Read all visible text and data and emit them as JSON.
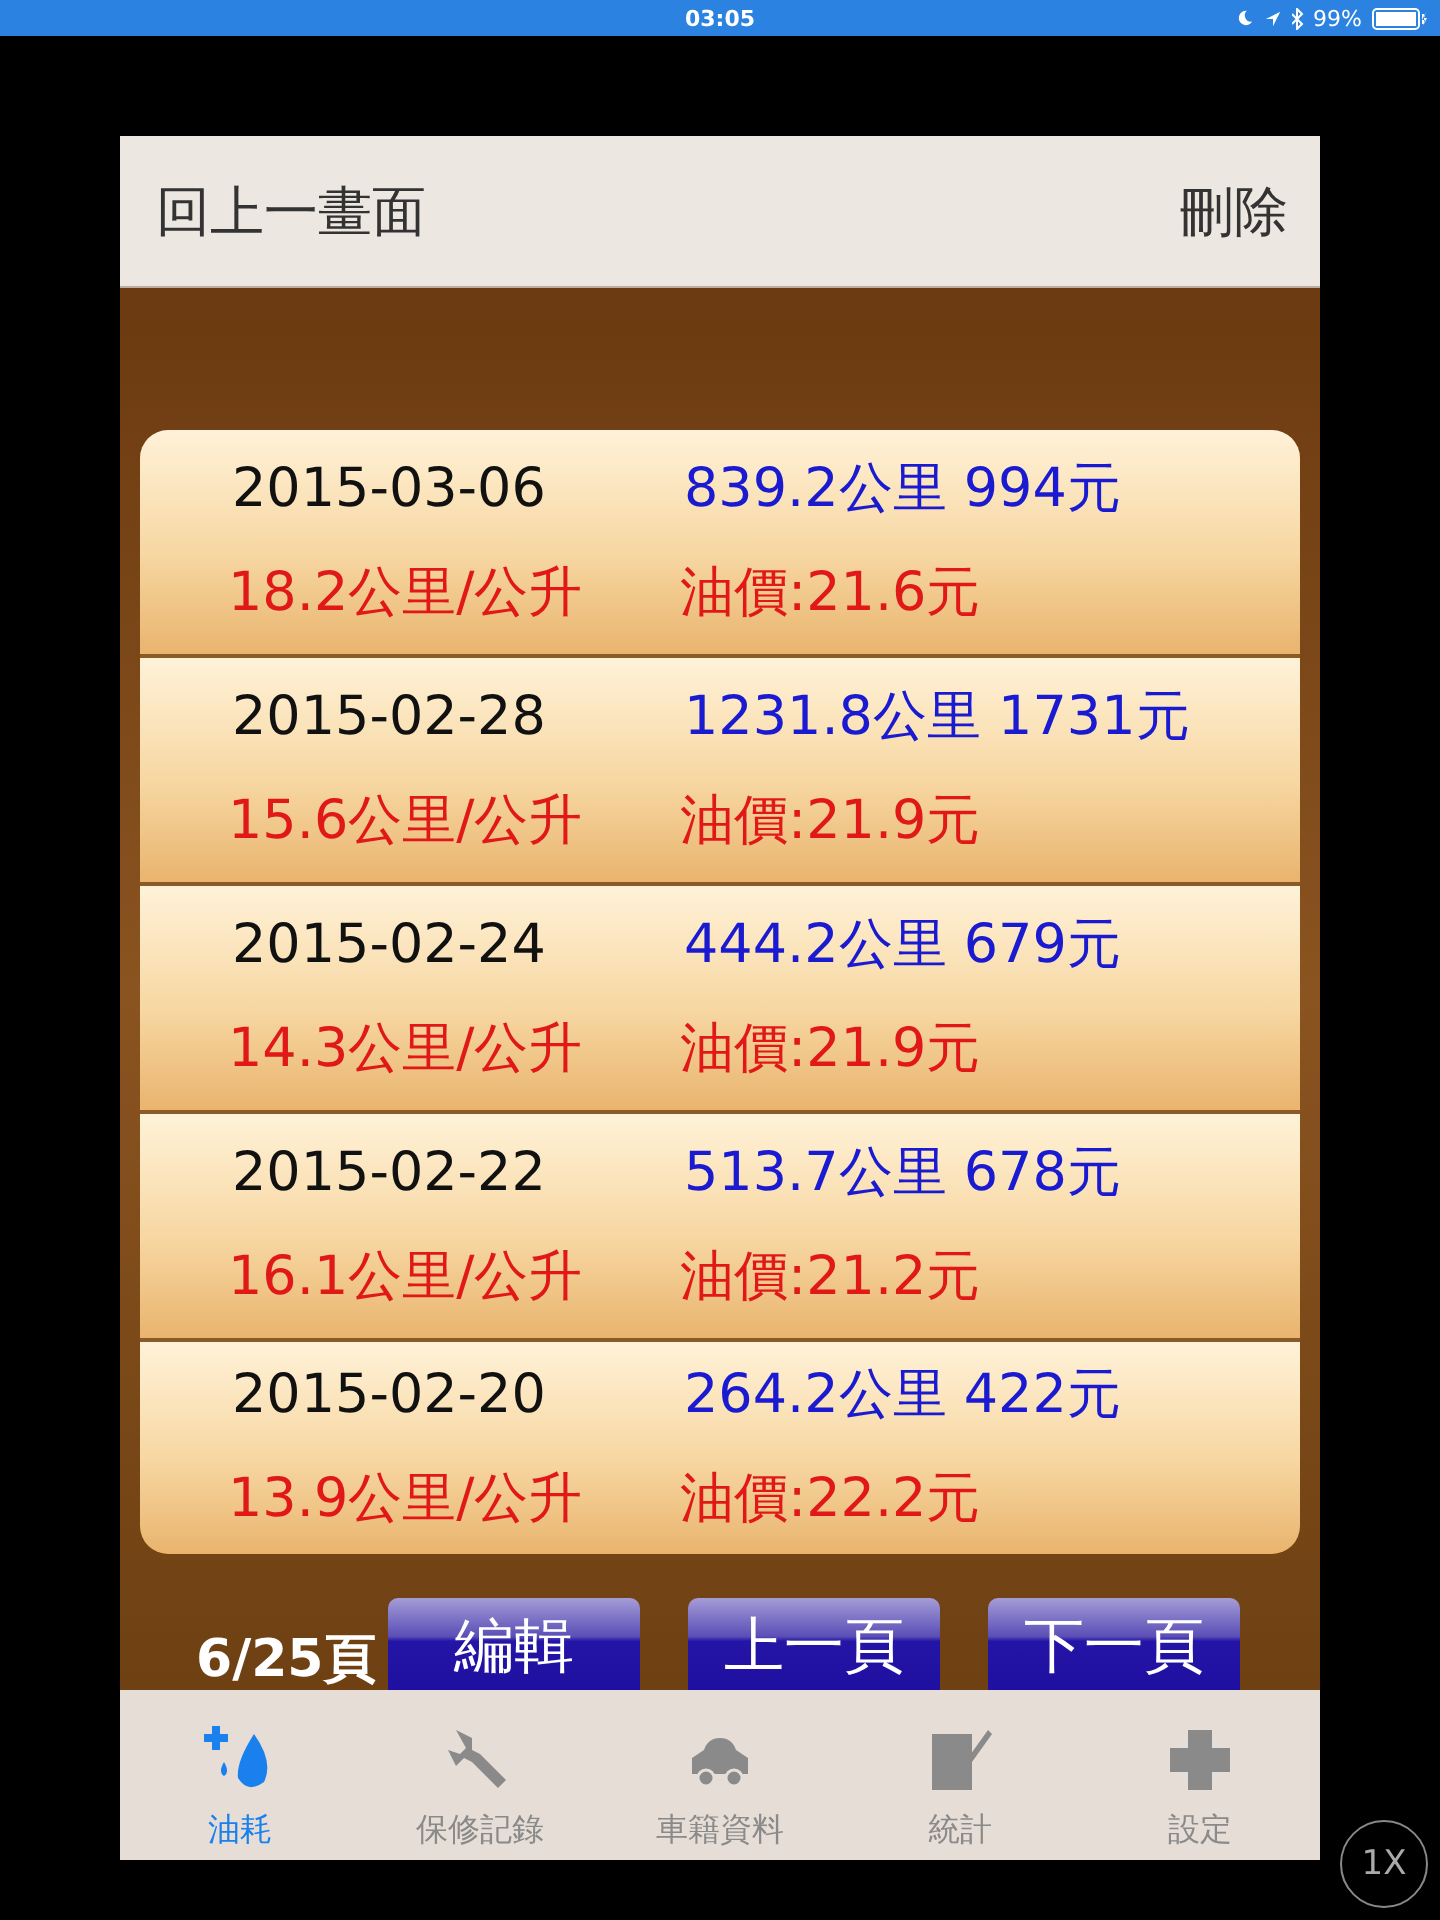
{
  "status_bar": {
    "time": "03:05",
    "battery": "99%"
  },
  "header": {
    "back": "回上一畫面",
    "delete": "刪除"
  },
  "records": [
    {
      "date": "2015-03-06",
      "distance_cost": "839.2公里 994元",
      "efficiency": "18.2公里/公升",
      "price": "油價:21.6元"
    },
    {
      "date": "2015-02-28",
      "distance_cost": "1231.8公里 1731元",
      "efficiency": "15.6公里/公升",
      "price": "油價:21.9元"
    },
    {
      "date": "2015-02-24",
      "distance_cost": "444.2公里 679元",
      "efficiency": "14.3公里/公升",
      "price": "油價:21.9元"
    },
    {
      "date": "2015-02-22",
      "distance_cost": "513.7公里 678元",
      "efficiency": "16.1公里/公升",
      "price": "油價:21.2元"
    },
    {
      "date": "2015-02-20",
      "distance_cost": "264.2公里 422元",
      "efficiency": "13.9公里/公升",
      "price": "油價:22.2元"
    }
  ],
  "pager": {
    "page": "6/25頁",
    "buttons": [
      "編輯",
      "上一頁",
      "下一頁"
    ]
  },
  "tabs": [
    {
      "label": "油耗",
      "kind": "fuel",
      "selected": true
    },
    {
      "label": "保修記錄",
      "kind": "wrench",
      "selected": false
    },
    {
      "label": "車籍資料",
      "kind": "car",
      "selected": false
    },
    {
      "label": "統計",
      "kind": "note",
      "selected": false
    },
    {
      "label": "設定",
      "kind": "plus",
      "selected": false
    }
  ],
  "zoom_button": "1X"
}
